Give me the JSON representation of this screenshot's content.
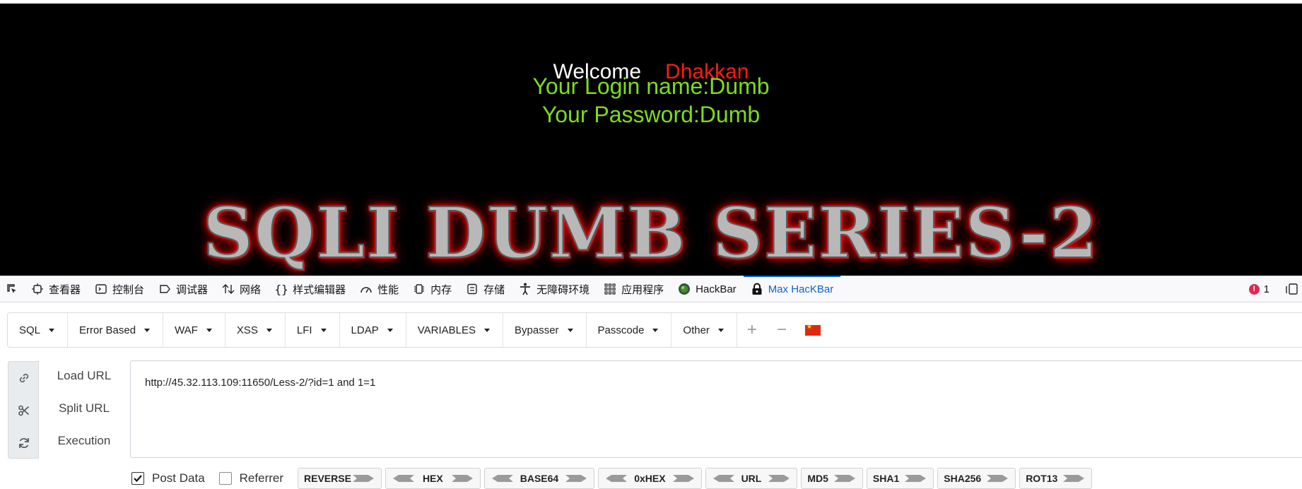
{
  "page": {
    "welcome_label": "Welcome",
    "welcome_name": "Dhakkan",
    "login_line": "Your Login name:Dumb",
    "password_line": "Your Password:Dumb",
    "banner": "SQLI DUMB SERIES-2"
  },
  "devtools": {
    "tabs": [
      {
        "label": "查看器",
        "icon": "inspector-icon"
      },
      {
        "label": "控制台",
        "icon": "console-icon"
      },
      {
        "label": "调试器",
        "icon": "debugger-icon"
      },
      {
        "label": "网络",
        "icon": "network-icon"
      },
      {
        "label": "样式编辑器",
        "icon": "style-editor-icon"
      },
      {
        "label": "性能",
        "icon": "performance-icon"
      },
      {
        "label": "内存",
        "icon": "memory-icon"
      },
      {
        "label": "存储",
        "icon": "storage-icon"
      },
      {
        "label": "无障碍环境",
        "icon": "accessibility-icon"
      },
      {
        "label": "应用程序",
        "icon": "application-icon"
      },
      {
        "label": "HackBar",
        "icon": "hackbar-icon"
      },
      {
        "label": "Max HacKBar",
        "icon": "lock-icon"
      }
    ],
    "error_count": "1",
    "active_color": "#0b61d6"
  },
  "hackbar": {
    "menu": [
      "SQL",
      "Error Based",
      "WAF",
      "XSS",
      "LFI",
      "LDAP",
      "VARIABLES",
      "Bypasser",
      "Passcode",
      "Other"
    ],
    "actions": {
      "load": "Load URL",
      "split": "Split URL",
      "execute": "Execution"
    },
    "url": "http://45.32.113.109:11650/Less-2/?id=1 and 1=1",
    "post_data_label": "Post Data",
    "post_data_checked": true,
    "referrer_label": "Referrer",
    "referrer_checked": false,
    "encoders": [
      "REVERSE",
      "HEX",
      "BASE64",
      "0xHEX",
      "URL",
      "MD5",
      "SHA1",
      "SHA256",
      "ROT13"
    ]
  }
}
